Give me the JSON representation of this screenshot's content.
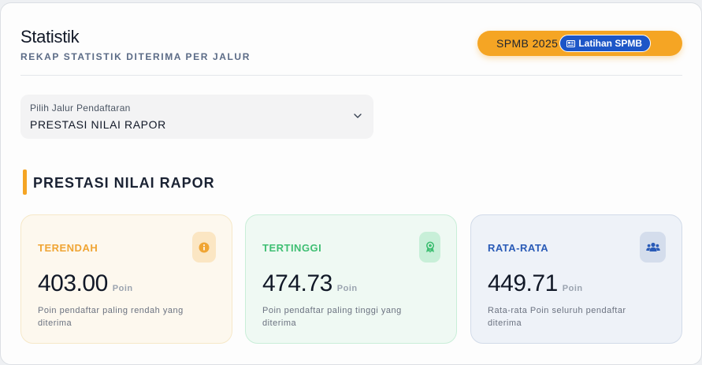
{
  "header": {
    "title": "Statistik",
    "subtitle": "REKAP STATISTIK DITERIMA PER JALUR",
    "pill_text": "SPMB 2025",
    "pill_badge": "Latihan SPMB"
  },
  "filter": {
    "label": "Pilih Jalur Pendaftaran",
    "value": "PRESTASI NILAI RAPOR"
  },
  "section": {
    "title": "PRESTASI NILAI RAPOR"
  },
  "cards": [
    {
      "label": "TERENDAH",
      "value": "403.00",
      "unit": "Poin",
      "desc": "Poin pendaftar paling rendah yang diterima",
      "icon": "info-icon"
    },
    {
      "label": "TERTINGGI",
      "value": "474.73",
      "unit": "Poin",
      "desc": "Poin pendaftar paling tinggi yang diterima",
      "icon": "award-icon"
    },
    {
      "label": "RATA-RATA",
      "value": "449.71",
      "unit": "Poin",
      "desc": "Rata-rata Poin seluruh pendaftar diterima",
      "icon": "users-icon"
    }
  ],
  "colors": {
    "accent": "#f5a524",
    "badge": "#1d56c7",
    "min": "#f0a534",
    "max": "#3fbf73",
    "avg": "#2a5bb7"
  }
}
